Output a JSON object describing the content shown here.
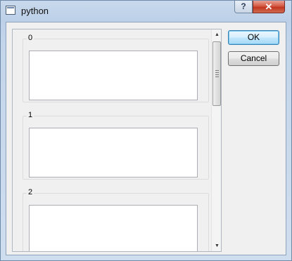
{
  "window": {
    "title": "python",
    "help_label": "?",
    "close_label": "✕"
  },
  "groups": [
    {
      "title": "0"
    },
    {
      "title": "1"
    },
    {
      "title": "2"
    }
  ],
  "scrollbar": {
    "up_arrow": "▲",
    "down_arrow": "▼"
  },
  "buttons": {
    "ok_label": "OK",
    "cancel_label": "Cancel"
  },
  "colors": {
    "close_button": "#c2351e",
    "default_button_border": "#3c7fb1"
  }
}
